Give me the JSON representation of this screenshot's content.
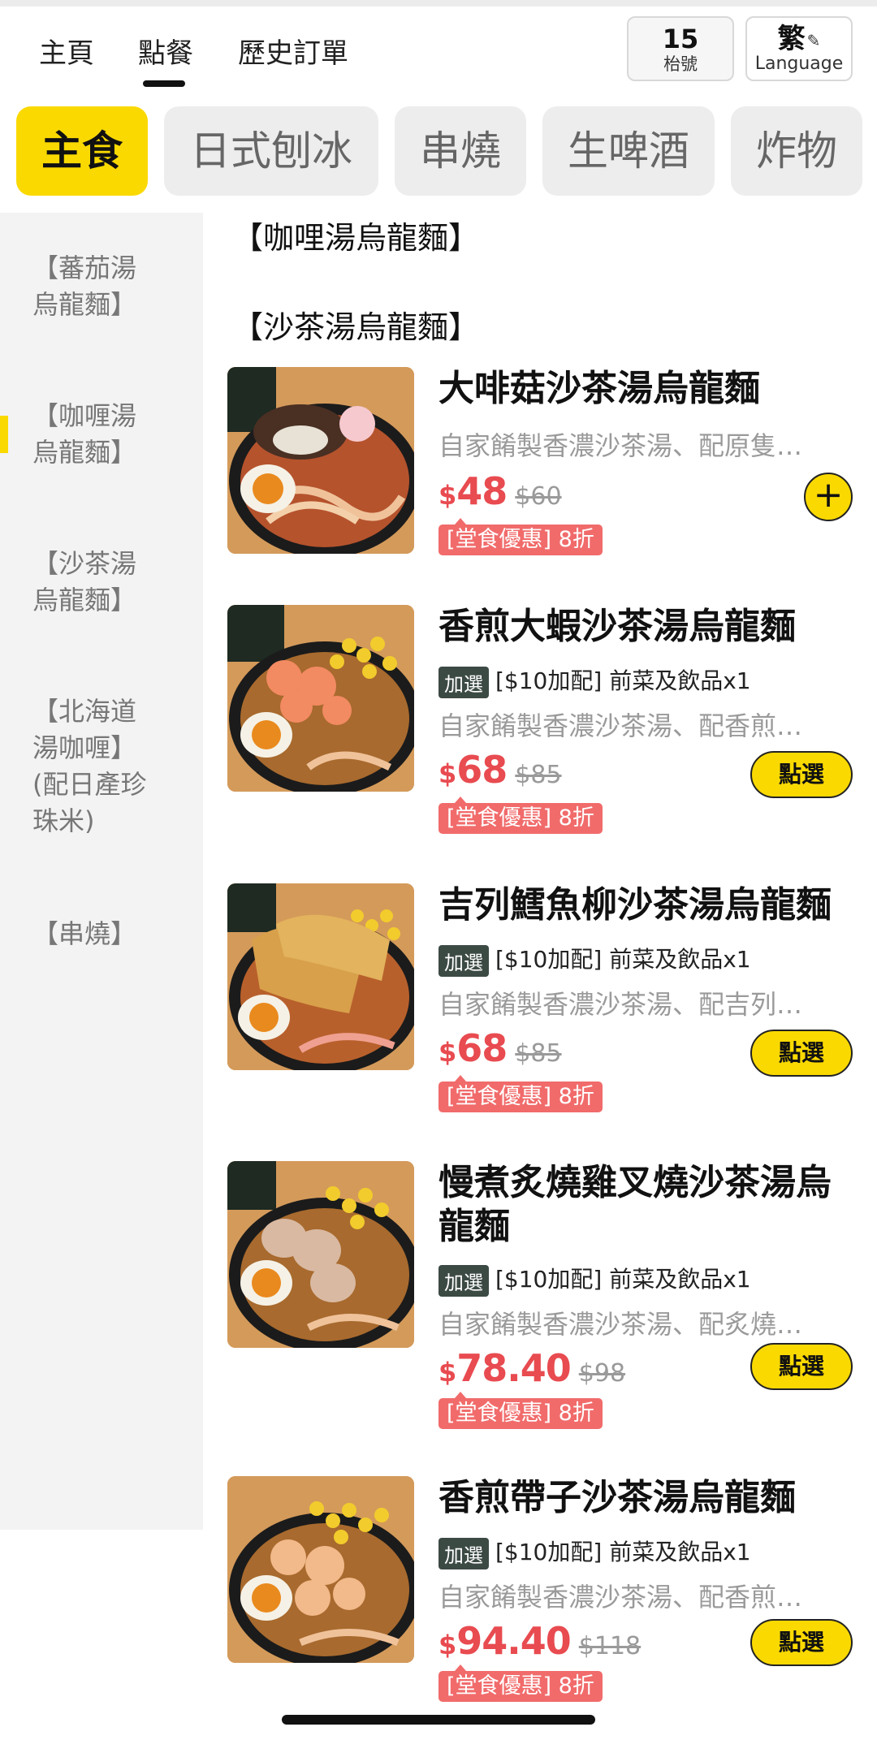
{
  "nav": {
    "tabs": [
      {
        "label": "主頁"
      },
      {
        "label": "點餐"
      },
      {
        "label": "歷史訂單"
      }
    ],
    "active_tab": "點餐",
    "table_number": "15",
    "table_label": "枱號",
    "language_char": "繁",
    "language_label": "Language"
  },
  "categories": [
    {
      "label": "主食",
      "active": true
    },
    {
      "label": "日式刨冰",
      "active": false
    },
    {
      "label": "串燒",
      "active": false
    },
    {
      "label": "生啤酒",
      "active": false
    },
    {
      "label": "炸物",
      "active": false
    }
  ],
  "sidebar": {
    "items": [
      {
        "lines": [
          "【蕃茄湯",
          "烏龍麵】"
        ]
      },
      {
        "lines": [
          "【咖喱湯",
          "烏龍麵】"
        ]
      },
      {
        "lines": [
          "【沙茶湯",
          "烏龍麵】"
        ]
      },
      {
        "lines": [
          "【北海道",
          "湯咖喱】",
          "(配日產珍",
          "珠米)"
        ]
      },
      {
        "lines": [
          "【串燒】"
        ]
      }
    ],
    "active_index": 1
  },
  "sections": [
    {
      "title": "【咖哩湯烏龍麵】"
    },
    {
      "title": "【沙茶湯烏龍麵】"
    }
  ],
  "products": [
    {
      "name": "大啡菇沙茶湯烏龍麵",
      "addon": null,
      "desc": "自家餚製香濃沙茶湯、配原隻…",
      "currency": "$",
      "price": "48",
      "orig_price": "$60",
      "promo": "[堂食優惠] 8折",
      "action": "plus",
      "action_label": "+"
    },
    {
      "name": "香煎大蝦沙茶湯烏龍麵",
      "addon_tag": "加選",
      "addon": "[$10加配] 前菜及飲品x1",
      "desc": "自家餚製香濃沙茶湯、配香煎…",
      "currency": "$",
      "price": "68",
      "orig_price": "$85",
      "promo": "[堂食優惠] 8折",
      "action": "select",
      "action_label": "點選"
    },
    {
      "name": "吉列鱈魚柳沙茶湯烏龍麵",
      "addon_tag": "加選",
      "addon": "[$10加配] 前菜及飲品x1",
      "desc": "自家餚製香濃沙茶湯、配吉列…",
      "currency": "$",
      "price": "68",
      "orig_price": "$85",
      "promo": "[堂食優惠] 8折",
      "action": "select",
      "action_label": "點選"
    },
    {
      "name": "慢煮炙燒雞叉燒沙茶湯烏龍麵",
      "addon_tag": "加選",
      "addon": "[$10加配] 前菜及飲品x1",
      "desc": "自家餚製香濃沙茶湯、配炙燒…",
      "currency": "$",
      "price": "78.40",
      "orig_price": "$98",
      "promo": "[堂食優惠] 8折",
      "action": "select",
      "action_label": "點選"
    },
    {
      "name": "香煎帶子沙茶湯烏龍麵",
      "addon_tag": "加選",
      "addon": "[$10加配] 前菜及飲品x1",
      "desc": "自家餚製香濃沙茶湯、配香煎…",
      "currency": "$",
      "price": "94.40",
      "orig_price": "$118",
      "promo": "[堂食優惠] 8折",
      "action": "select",
      "action_label": "點選"
    }
  ],
  "colors": {
    "accent": "#fad900",
    "price": "#e84b50",
    "promo": "#f16b6b",
    "addon_tag": "#3c4a44"
  }
}
